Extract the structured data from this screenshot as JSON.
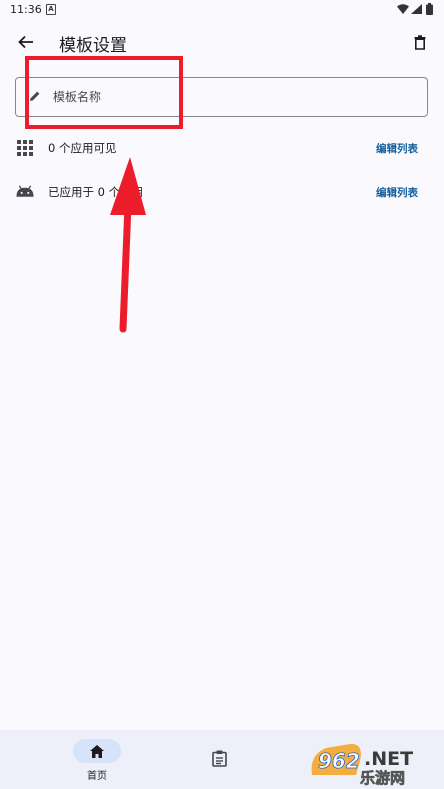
{
  "status_bar": {
    "time": "11:36",
    "notification_glyph": "A"
  },
  "app_bar": {
    "title": "模板设置",
    "back_icon": "arrow-left-icon",
    "delete_icon": "trash-icon"
  },
  "name_field": {
    "placeholder": "模板名称",
    "value": "",
    "icon": "pencil-icon"
  },
  "rows": [
    {
      "label": "0 个应用可见",
      "action": "编辑列表",
      "icon": "apps-grid-icon"
    },
    {
      "label": "已应用于 0 个应用",
      "action": "编辑列表",
      "icon": "android-icon"
    }
  ],
  "bottom_nav": {
    "home_label": "首页",
    "home_icon": "home-icon",
    "list_icon": "clipboard-icon"
  },
  "watermark": {
    "brand": "962",
    "suffix": ".NET",
    "site": "乐游网"
  },
  "colors": {
    "background": "#fafafe",
    "accent_link": "#14609e",
    "annotation": "#ec1c2a",
    "nav_background": "#edf0f8",
    "nav_pill": "#d6e3f8"
  }
}
